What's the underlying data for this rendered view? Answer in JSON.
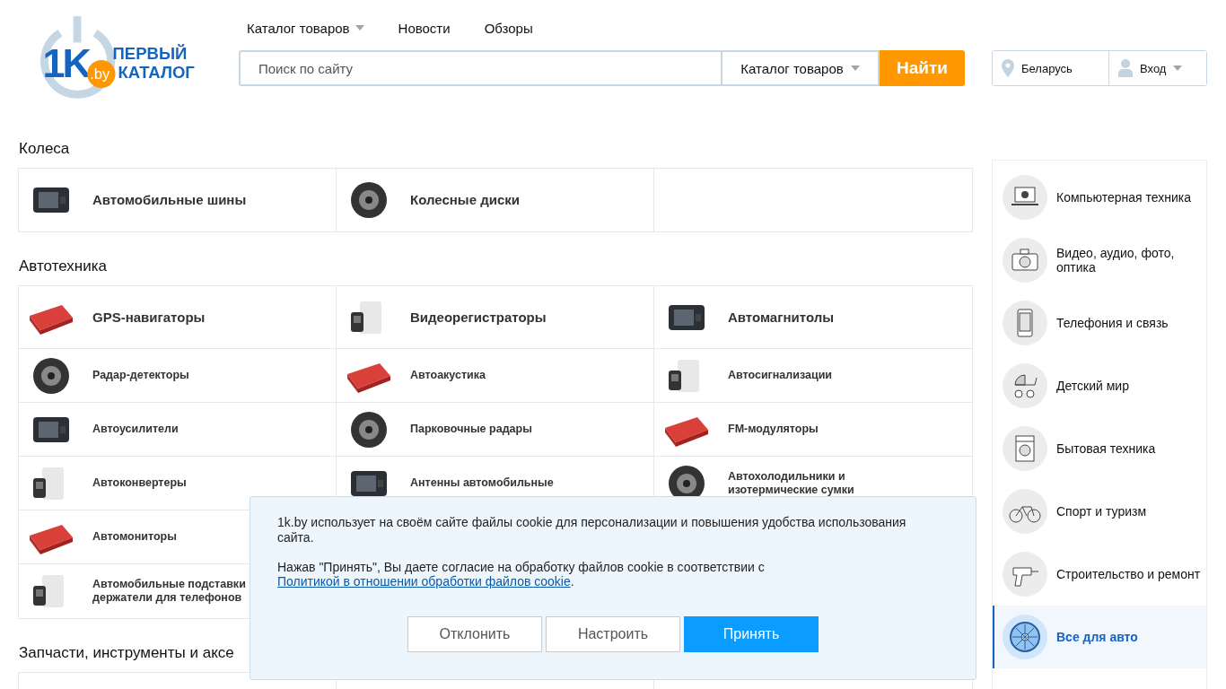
{
  "logo": {
    "mark": "1K",
    "domain": ".by",
    "line1": "ПЕРВЫЙ",
    "line2": "КАТАЛОГ"
  },
  "nav": [
    {
      "label": "Каталог товаров",
      "dropdown": true
    },
    {
      "label": "Новости",
      "dropdown": false
    },
    {
      "label": "Обзоры",
      "dropdown": false
    }
  ],
  "search": {
    "placeholder": "Поиск по сайту",
    "scope": "Каталог товаров",
    "button": "Найти"
  },
  "region": "Беларусь",
  "login": "Вход",
  "sections": [
    {
      "title": "Колеса",
      "rows": [
        {
          "large": true,
          "items": [
            {
              "label": "Автомобильные шины"
            },
            {
              "label": "Колесные диски"
            }
          ]
        }
      ]
    },
    {
      "title": "Автотехника",
      "rows": [
        {
          "large": true,
          "items": [
            {
              "label": "GPS-навигаторы"
            },
            {
              "label": "Видеорегистраторы"
            },
            {
              "label": "Автомагнитолы"
            }
          ]
        },
        {
          "large": false,
          "items": [
            {
              "label": "Радар-детекторы"
            },
            {
              "label": "Автоакустика"
            },
            {
              "label": "Автосигнализации"
            }
          ]
        },
        {
          "large": false,
          "items": [
            {
              "label": "Автоусилители"
            },
            {
              "label": "Парковочные радары"
            },
            {
              "label": "FM-модуляторы"
            }
          ]
        },
        {
          "large": false,
          "items": [
            {
              "label": "Автоконвертеры"
            },
            {
              "label": "Антенны автомобильные"
            },
            {
              "label": "Автохолодильники и изотермические сумки"
            }
          ]
        },
        {
          "large": false,
          "items": [
            {
              "label": "Автомониторы"
            }
          ]
        },
        {
          "large": false,
          "items": [
            {
              "label": "Автомобильные подставки держатели для телефонов"
            }
          ]
        }
      ]
    },
    {
      "title": "Запчасти, инструменты и аксе"
    }
  ],
  "categories": [
    {
      "label": "Компьютерная техника",
      "selected": false
    },
    {
      "label": "Видео, аудио, фото, оптика",
      "selected": false
    },
    {
      "label": "Телефония и связь",
      "selected": false
    },
    {
      "label": "Детский мир",
      "selected": false
    },
    {
      "label": "Бытовая техника",
      "selected": false
    },
    {
      "label": "Спорт и туризм",
      "selected": false
    },
    {
      "label": "Строительство и ремонт",
      "selected": false
    },
    {
      "label": "Все для авто",
      "selected": true
    }
  ],
  "cookie": {
    "text": "1k.by использует на своём сайте файлы cookie для персонализации и повышения удобства использования сайта.",
    "consent": "Нажав \"Принять\", Вы даете согласие на обработку файлов cookie в соответствии с",
    "link": "Политикой в отношении обработки файлов cookie",
    "end": ".",
    "buttons": [
      {
        "label": "Отклонить",
        "primary": false
      },
      {
        "label": "Настроить",
        "primary": false
      },
      {
        "label": "Принять",
        "primary": true
      }
    ]
  }
}
